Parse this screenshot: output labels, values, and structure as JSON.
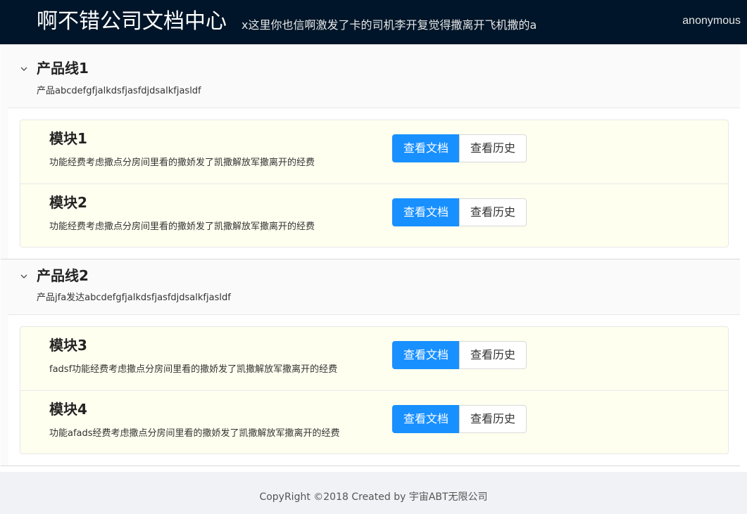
{
  "header": {
    "title": "啊不错公司文档中心",
    "subtitle": "x这里你也信啊激发了卡的司机李开复觉得撒离开飞机撒的a",
    "user": "anonymous"
  },
  "product_lines": [
    {
      "title": "产品线1",
      "description": "产品abcdefgfjalkdsfjasfdjdsalkfjasldf",
      "modules": [
        {
          "title": "模块1",
          "description": "功能经费考虑撒点分房间里看的撒娇发了凯撒解放军撒离开的经费",
          "view_label": "查看文档",
          "history_label": "查看历史"
        },
        {
          "title": "模块2",
          "description": "功能经费考虑撒点分房间里看的撒娇发了凯撒解放军撒离开的经费",
          "view_label": "查看文档",
          "history_label": "查看历史"
        }
      ]
    },
    {
      "title": "产品线2",
      "description": "产品jfa发达abcdefgfjalkdsfjasfdjdsalkfjasldf",
      "modules": [
        {
          "title": "模块3",
          "description": "fadsf功能经费考虑撒点分房间里看的撒娇发了凯撒解放军撒离开的经费",
          "view_label": "查看文档",
          "history_label": "查看历史"
        },
        {
          "title": "模块4",
          "description": "功能afads经费考虑撒点分房间里看的撒娇发了凯撒解放军撒离开的经费",
          "view_label": "查看文档",
          "history_label": "查看历史"
        }
      ]
    }
  ],
  "footer": {
    "copyright": "CopyRight ©2018 Created by 宇宙ABT无限公司"
  },
  "colors": {
    "header_bg": "#001529",
    "primary": "#1890ff",
    "module_bg": "#fffff0"
  },
  "icons": {
    "expand": "chevron-down-icon"
  }
}
